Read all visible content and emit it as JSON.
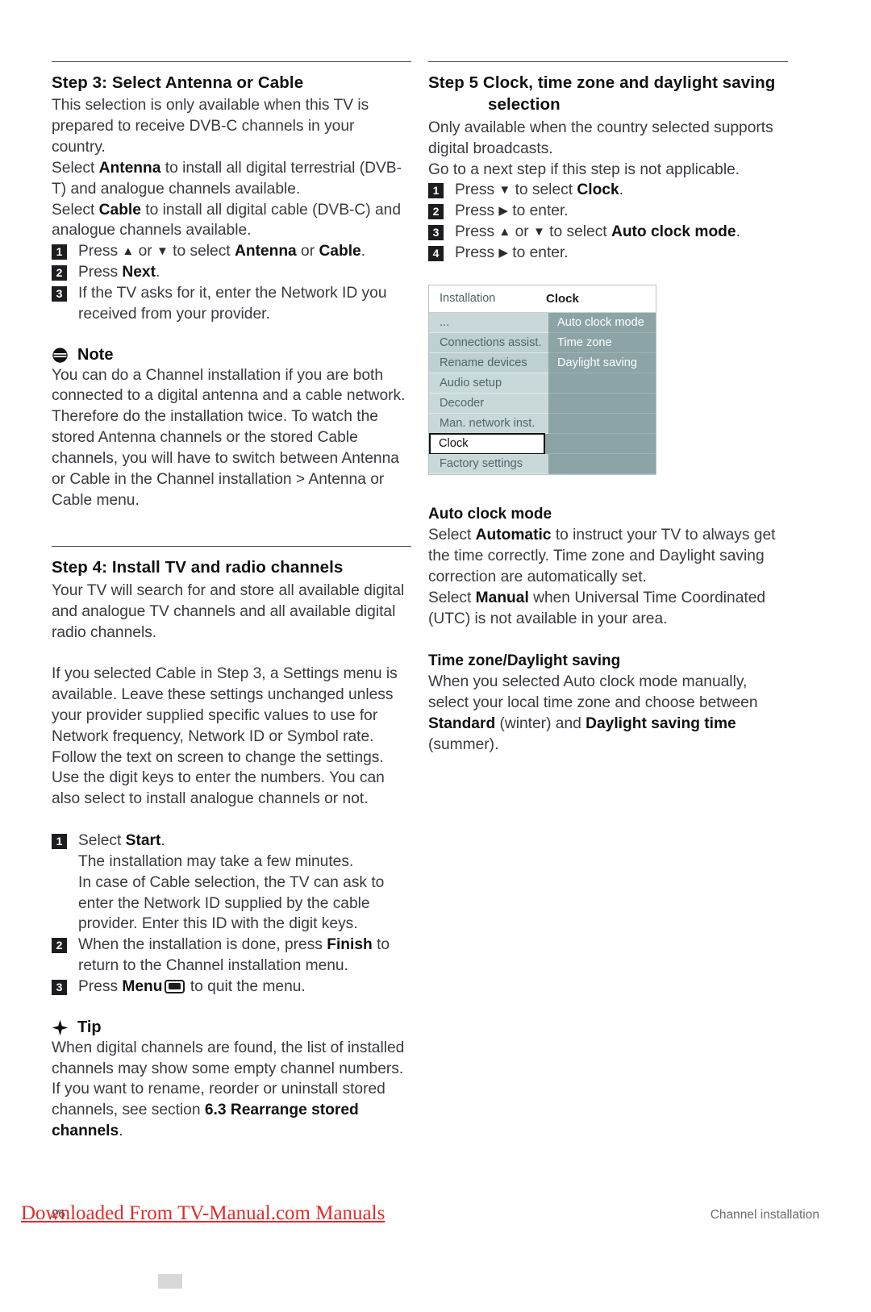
{
  "left_column": {
    "step3": {
      "title": "Step 3:  Select  Antenna or Cable",
      "p1": "This selection is only available when this TV is prepared to receive DVB-C channels in your country.",
      "p2_a": "Select ",
      "p2_b": "Antenna",
      "p2_c": " to install all digital terrestrial (DVB-T) and analogue channels available.",
      "p3_a": "Select ",
      "p3_b": "Cable",
      "p3_c": " to install all digital cable (DVB-C) and analogue channels available.",
      "steps": [
        {
          "num": "1",
          "pre": "Press ",
          "arrow1": "▲",
          "mid": " or ",
          "arrow2": "▼",
          "post": " to select ",
          "bold1": "Antenna",
          "join": " or ",
          "bold2": "Cable",
          "end": "."
        },
        {
          "num": "2",
          "pre": "Press ",
          "bold1": "Next",
          "end": "."
        },
        {
          "num": "3",
          "text": "If the TV asks for it, enter the Network ID you received from your provider."
        }
      ]
    },
    "note": {
      "icon": "note-icon",
      "label": "Note",
      "text": "You can do a Channel installation if you are both connected to a digital antenna and a cable network. Therefore do the installation twice. To watch the stored Antenna channels or the stored Cable channels, you will have to switch between Antenna or Cable in the Channel installation > Antenna or Cable menu."
    },
    "step4": {
      "title": "Step 4: Install TV and radio channels",
      "p1": "Your TV will search for and store all available digital and analogue TV channels and all available digital radio channels.",
      "p2": "If you selected Cable in Step 3, a Settings menu is available. Leave these settings unchanged unless your provider supplied specific values to use for Network frequency, Network ID or Symbol rate. Follow the text on screen to change the settings. Use the digit keys to enter the numbers. You can also select to install analogue channels or not.",
      "steps": [
        {
          "num": "1",
          "pre": "Select ",
          "bold1": "Start",
          "end": ".",
          "sublines": [
            "The installation may take a few minutes.",
            "In case of Cable selection, the TV can ask to enter the Network ID supplied by the cable provider. Enter this ID with the digit keys."
          ]
        },
        {
          "num": "2",
          "pre": "When the installation is done, press ",
          "bold1": "Finish",
          "end": " to return to the Channel installation menu."
        },
        {
          "num": "3",
          "pre": "Press ",
          "bold1": "Menu",
          "icon": "menu-key-icon",
          "end": " to quit the menu."
        }
      ]
    },
    "tip": {
      "icon": "tip-icon",
      "label": "Tip",
      "text_a": "When digital channels are found, the list of installed channels may show some empty channel numbers. If you want to rename, reorder or uninstall stored channels, see section ",
      "text_bold": "6.3 Rearrange stored channels",
      "text_end": "."
    }
  },
  "right_column": {
    "step5": {
      "title_line1": "Step 5  Clock, time zone and daylight saving",
      "title_line2": "selection",
      "p1": "Only available when the country selected supports digital broadcasts.",
      "p2": "Go to a next step if this step is not applicable.",
      "steps": [
        {
          "num": "1",
          "pre": "Press ",
          "arrow1": "▼",
          "post": " to select ",
          "bold1": "Clock",
          "end": "."
        },
        {
          "num": "2",
          "pre": "Press ",
          "arrow1": "▶",
          "post": " to enter.",
          "end": ""
        },
        {
          "num": "3",
          "pre": "Press ",
          "arrow1": "▲",
          "mid": " or ",
          "arrow2": "▼",
          "post": " to select ",
          "bold1": "Auto clock mode",
          "end": "."
        },
        {
          "num": "4",
          "pre": "Press ",
          "arrow1": "▶",
          "post": " to enter.",
          "end": ""
        }
      ]
    },
    "tv_menu": {
      "header_left": "Installation",
      "header_right": "Clock",
      "left_items": [
        {
          "label": "...",
          "selected": false
        },
        {
          "label": "Connections assist.",
          "selected": false
        },
        {
          "label": "Rename devices",
          "selected": false
        },
        {
          "label": "Audio setup",
          "selected": false
        },
        {
          "label": "Decoder",
          "selected": false
        },
        {
          "label": "Man. network inst.",
          "selected": false
        },
        {
          "label": "Clock",
          "selected": true
        },
        {
          "label": "Factory settings",
          "selected": false
        }
      ],
      "right_items": [
        "Auto clock mode",
        "Time zone",
        "Daylight saving",
        "",
        "",
        "",
        "",
        ""
      ]
    },
    "auto_clock": {
      "title": "Auto clock mode",
      "p1_a": "Select ",
      "p1_b": "Automatic",
      "p1_c": " to instruct your TV to always get the time correctly. Time zone and Daylight saving correction are automatically set.",
      "p2_a": "Select ",
      "p2_b": "Manual",
      "p2_c": " when Universal Time Coordinated (UTC) is not available in your area."
    },
    "time_zone": {
      "title": "Time zone/Daylight saving",
      "p1_a": "When you selected Auto clock mode manually, select your local time zone and choose between ",
      "p1_b": "Standard",
      "p1_c": " (winter) and ",
      "p1_d": "Daylight saving time",
      "p1_e": " (summer)."
    }
  },
  "footer": {
    "page_number": "26",
    "section_label": "Channel installation",
    "watermark": "Downloaded From TV-Manual.com Manuals"
  },
  "colors": {
    "accent_red": "#e22b2b",
    "menu_left_bg": "#c9d9d9",
    "menu_right_bg": "#8ca4a6",
    "text": "#3a3a3f"
  }
}
